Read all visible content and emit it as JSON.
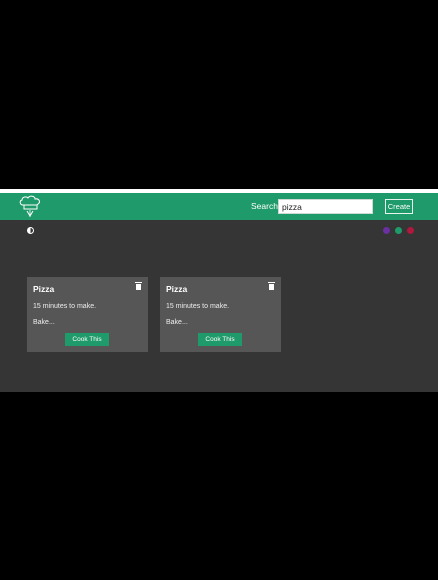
{
  "navbar": {
    "logo_icon": "chef-hat-logo-icon",
    "search_label": "Search:",
    "search_value": "pizza",
    "create_label": "Create"
  },
  "controls": {
    "contrast_icon": "contrast-toggle-icon",
    "theme_colors": [
      "#6a2fa0",
      "#1f9a6a",
      "#b0183e"
    ]
  },
  "recipes": [
    {
      "title": "Pizza",
      "time": "15 minutes to make.",
      "description": "Bake...",
      "cook_label": "Cook This",
      "delete_icon": "trash-icon"
    },
    {
      "title": "Pizza",
      "time": "15 minutes to make.",
      "description": "Bake...",
      "cook_label": "Cook This",
      "delete_icon": "trash-icon"
    }
  ],
  "colors": {
    "brand": "#1f9a6a",
    "content_bg": "#353535",
    "card_bg": "#565656"
  }
}
